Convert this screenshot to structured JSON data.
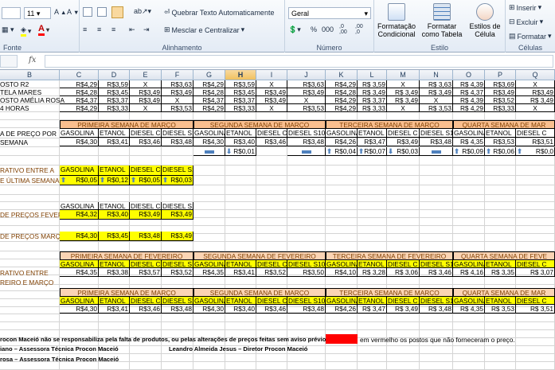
{
  "ribbon": {
    "font_size": "11",
    "wrap_text": "Quebrar Texto Automaticamente",
    "merge_center": "Mesclar e Centralizar",
    "number_format": "Geral",
    "cond_format": [
      "Formatação",
      "Condicional"
    ],
    "format_table": [
      "Formatar",
      "como Tabela"
    ],
    "cell_styles": [
      "Estilos de",
      "Célula"
    ],
    "insert": "Inserir",
    "delete": "Excluir",
    "format": "Formatar",
    "groups": {
      "font": "Fonte",
      "alignment": "Alinhamento",
      "number": "Número",
      "style": "Estilo",
      "cells": "Células"
    },
    "pct": "%",
    "thousands": "000",
    "dec_inc": ",0\n,00",
    "dec_dec": ",00\n,0"
  },
  "formula_bar": {
    "fx": "fx"
  },
  "columns": [
    "B",
    "C",
    "D",
    "E",
    "F",
    "G",
    "H",
    "I",
    "J",
    "K",
    "L",
    "M",
    "N",
    "O",
    "P",
    "Q"
  ],
  "selected_column": "H",
  "rows": {
    "r1": {
      "label": "OSTO R2",
      "vals": [
        "R$4,29",
        "R$3,59",
        "X",
        "R$3,63",
        "R$4,29",
        "R$3,59",
        "X",
        "R$3,63",
        "R$4,29",
        "R$ 3,59",
        "X",
        "R$ 3,63",
        "R$ 4,39",
        "R$3,69",
        "X"
      ]
    },
    "r2": {
      "label": "TELA MARES",
      "vals": [
        "R$4,28",
        "R$3,45",
        "R$3,49",
        "R$3,49",
        "R$4,28",
        "R$3,45",
        "R$3,49",
        "R$3,49",
        "R$4,28",
        "R$ 3,49",
        "R$ 3,49",
        "R$ 3,49",
        "R$ 4,37",
        "R$3,49",
        "R$3,49"
      ]
    },
    "r3": {
      "label": "OSTO AMÉLIA ROSA",
      "vals": [
        "R$4,37",
        "R$3,37",
        "R$3,49",
        "X",
        "R$4,37",
        "R$3,37",
        "R$3,49",
        "X",
        "R$4,29",
        "R$ 3,37",
        "R$ 3,49",
        "X",
        "R$ 4,39",
        "R$3,52",
        "R$ 3,49"
      ]
    },
    "r4": {
      "label": "4 HORAS",
      "vals": [
        "R$4,29",
        "R$3,33",
        "X",
        "R$3,53",
        "R$4,29",
        "R$3,33",
        "X",
        "R$3,53",
        "R$4,29",
        "R$ 3,33",
        "X",
        "R$ 3,53",
        "R$ 4,29",
        "R$3,33",
        "X"
      ]
    }
  },
  "media_label": [
    "A DE PREÇO POR",
    "SEMANA"
  ],
  "weeks_march": [
    "PRIMEIRA SEMANA DE MARÇO",
    "SEGUNDA SEMANA DE MARÇO",
    "TERCEIRA SEMANA DE MARÇO",
    "QUARTA SEMANA DE MAR"
  ],
  "fuel_headers": [
    "GASOLINA",
    "ETANOL",
    "DIESEL C",
    "DIESEL S10"
  ],
  "fuel_headers_alt": [
    "GASOLINA",
    "ETANOL",
    "DIESEL C",
    "DIESEL S10",
    "GASOLINA",
    "ETANOL",
    "DIESEL C",
    "DIESEL S10",
    "GASOLINA",
    "ETANOL",
    "DIESEL C",
    "DIESEL S10",
    "GASOLINA",
    "ETANOL",
    "DIESEL C"
  ],
  "avg_march": [
    "R$4,30",
    "R$3,41",
    "R$3,46",
    "R$3,48",
    "R$4,30",
    "R$3,40",
    "R$3,46",
    "R$3,48",
    "R$4,26",
    "R$3,47",
    "R$3,49",
    "R$3,48",
    "R$ 4,35",
    "R$3,53",
    "R$3,51"
  ],
  "var_march": {
    "H": "R$0,01",
    "K": "R$0,04",
    "L": "R$0,07",
    "M": "R$0,03",
    "O": "R$0,09",
    "P": "R$0,06",
    "Q": "R$0,0"
  },
  "comp_label": [
    "RATIVO ENTRE A",
    "E ÚLTIMA SEMANA"
  ],
  "comp_headers": [
    "GASOLINA",
    "ETANOL",
    "DIESEL C",
    "DIESEL S10"
  ],
  "comp_vals": [
    "R$0,05",
    "R$0,12",
    "R$0,05",
    "R$0,03"
  ],
  "avg_feb_label": "DE PREÇOS FEVEREI",
  "avg_feb_headers": [
    "GASOLINA",
    "ETANOL",
    "DIESEL C",
    "DIESEL S10"
  ],
  "avg_feb_vals": [
    "R$4,32",
    "R$3,40",
    "R$3,49",
    "R$3,49"
  ],
  "avg_mar_label": "DE PREÇOS MARÇO",
  "avg_mar_vals": [
    "R$4,30",
    "R$3,45",
    "R$3,48",
    "R$3,49"
  ],
  "weeks_feb": [
    "PRIMEIRA SEMANA DE FEVEREIRO",
    "SEGUNDA SEMANA DE FEVEREIRO",
    "TERCEIRA SEMANA DE FEVEREIRO",
    "QUARTA SEMANA DE FEVE"
  ],
  "feb_compare_label": [
    "RATIVO ENTRE",
    "REIRO E MARÇO"
  ],
  "feb_week_vals": [
    "R$4,35",
    "R$3,38",
    "R$3,57",
    "R$3,52",
    "R$4,35",
    "R$3,41",
    "R$3,52",
    "R$3,50",
    "R$4,10",
    "R$ 3,28",
    "R$ 3,06",
    "R$ 3,46",
    "R$ 4,16",
    "R$ 3,35",
    "R$ 3,07"
  ],
  "mar_week_vals": [
    "R$4,30",
    "R$3,41",
    "R$3,46",
    "R$3,48",
    "R$4,30",
    "R$3,40",
    "R$3,46",
    "R$3,48",
    "R$4,26",
    "R$ 3,47",
    "R$ 3,49",
    "R$ 3,48",
    "R$ 4,35",
    "R$ 3,53",
    "R$ 3,51"
  ],
  "footer": {
    "disclaimer": "rocon Maceió não se responsabiliza pela falta de produtos, ou pelas alterações de preços feitas sem aviso prévio.",
    "legend": "em vermelho os postos que não forneceram o preço.",
    "sig1": "iano – Assessora Técnica Procon Maceió",
    "sig2": "Leandro Almeida Jesus – Diretor Procon Maceió",
    "sig3": "rosa – Assessora Técnica Procon Maceió"
  },
  "colors": {
    "header_peach": "#fbd4b4",
    "header_orange": "#fabf8f",
    "highlight": "#ffff00",
    "legend_red": "#ff0000",
    "arrow": "#4f81bd"
  }
}
